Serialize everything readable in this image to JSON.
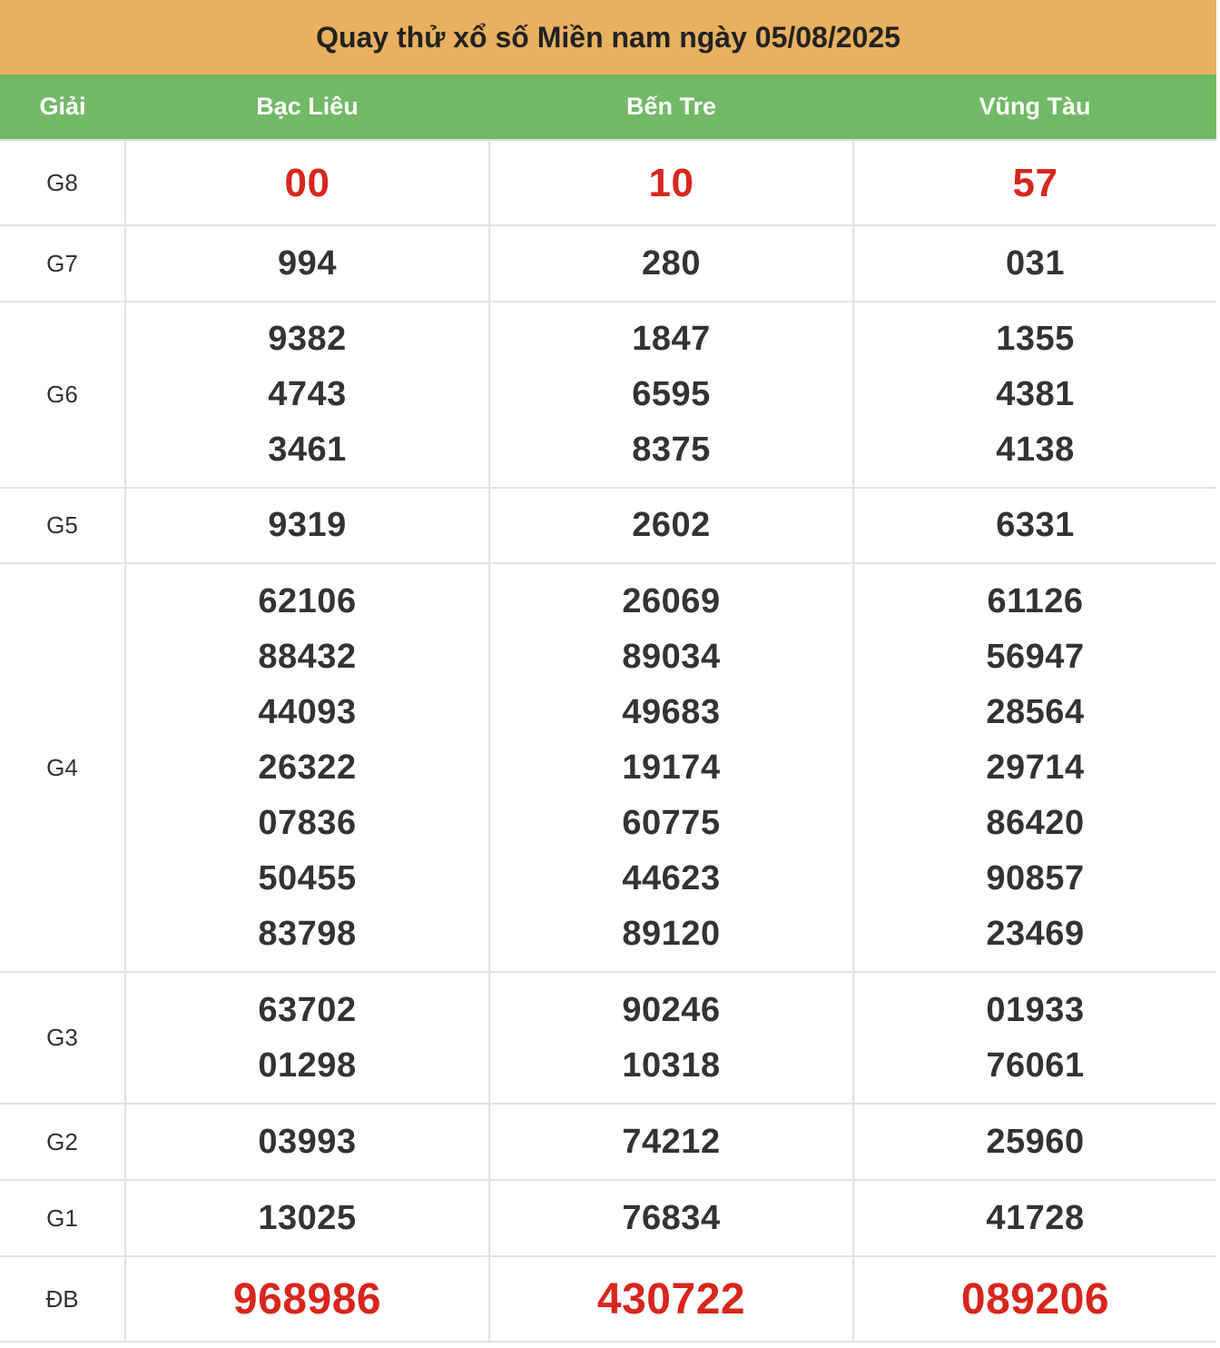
{
  "title": "Quay thử xổ số Miền nam ngày 05/08/2025",
  "header": {
    "prize": "Giải",
    "provinces": [
      "Bạc Liêu",
      "Bến Tre",
      "Vũng Tàu"
    ]
  },
  "rows": [
    {
      "label": "G8",
      "style": "red",
      "values": [
        [
          "00"
        ],
        [
          "10"
        ],
        [
          "57"
        ]
      ]
    },
    {
      "label": "G7",
      "style": "normal",
      "values": [
        [
          "994"
        ],
        [
          "280"
        ],
        [
          "031"
        ]
      ]
    },
    {
      "label": "G6",
      "style": "normal",
      "values": [
        [
          "9382",
          "4743",
          "3461"
        ],
        [
          "1847",
          "6595",
          "8375"
        ],
        [
          "1355",
          "4381",
          "4138"
        ]
      ]
    },
    {
      "label": "G5",
      "style": "normal",
      "values": [
        [
          "9319"
        ],
        [
          "2602"
        ],
        [
          "6331"
        ]
      ]
    },
    {
      "label": "G4",
      "style": "normal",
      "values": [
        [
          "62106",
          "88432",
          "44093",
          "26322",
          "07836",
          "50455",
          "83798"
        ],
        [
          "26069",
          "89034",
          "49683",
          "19174",
          "60775",
          "44623",
          "89120"
        ],
        [
          "61126",
          "56947",
          "28564",
          "29714",
          "86420",
          "90857",
          "23469"
        ]
      ]
    },
    {
      "label": "G3",
      "style": "normal",
      "values": [
        [
          "63702",
          "01298"
        ],
        [
          "90246",
          "10318"
        ],
        [
          "01933",
          "76061"
        ]
      ]
    },
    {
      "label": "G2",
      "style": "normal",
      "values": [
        [
          "03993"
        ],
        [
          "74212"
        ],
        [
          "25960"
        ]
      ]
    },
    {
      "label": "G1",
      "style": "normal",
      "values": [
        [
          "13025"
        ],
        [
          "76834"
        ],
        [
          "41728"
        ]
      ]
    },
    {
      "label": "ĐB",
      "style": "big-red",
      "values": [
        [
          "968986"
        ],
        [
          "430722"
        ],
        [
          "089206"
        ]
      ]
    }
  ]
}
